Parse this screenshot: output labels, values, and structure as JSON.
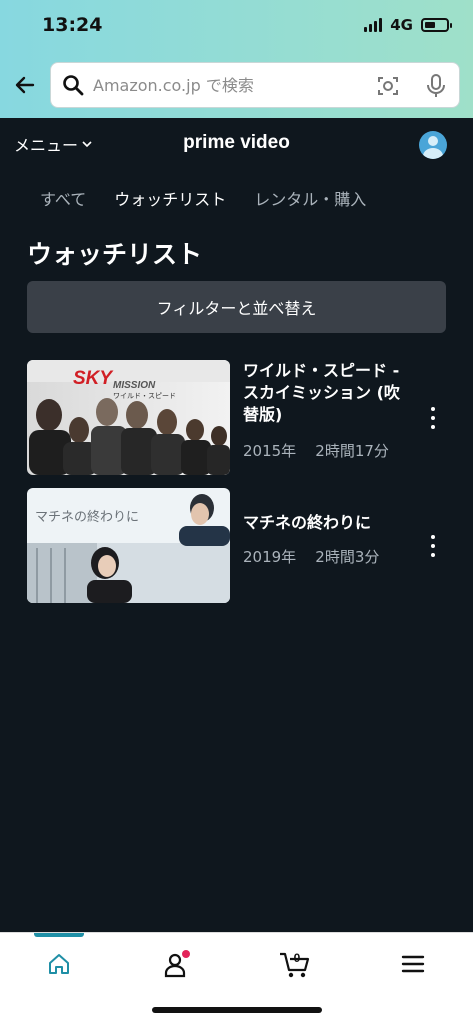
{
  "status_bar": {
    "time": "13:24",
    "network": "4G"
  },
  "search": {
    "placeholder": "Amazon.co.jp で検索"
  },
  "header": {
    "menu_label": "メニュー",
    "brand": "prime video"
  },
  "tabs": [
    {
      "label": "すべて",
      "active": false
    },
    {
      "label": "ウォッチリスト",
      "active": true
    },
    {
      "label": "レンタル・購入",
      "active": false
    }
  ],
  "page_title": "ウォッチリスト",
  "filter_button": "フィルターと並べ替え",
  "watchlist": [
    {
      "title_lines": [
        "ワイルド・スピード -",
        "スカイミッション (吹",
        "替版)"
      ],
      "year": "2015年",
      "duration": "2時間17分",
      "thumbnail_text": {
        "main": "SKY",
        "sub": "MISSION",
        "tagline": "ワイルド・スピード"
      }
    },
    {
      "title_lines": [
        "マチネの終わりに"
      ],
      "year": "2019年",
      "duration": "2時間3分",
      "thumbnail_text": {
        "main": "マチネの終わりに"
      }
    }
  ],
  "bottom_nav": {
    "cart_count": "0",
    "items": [
      "home-icon",
      "account-icon",
      "cart-icon",
      "menu-icon"
    ],
    "accent_color": "#1f8fa6",
    "notification_color": "#e3245a"
  },
  "colors": {
    "background": "#0f171e",
    "filter_bg": "#3a4048",
    "muted_text": "#aab3bb"
  }
}
